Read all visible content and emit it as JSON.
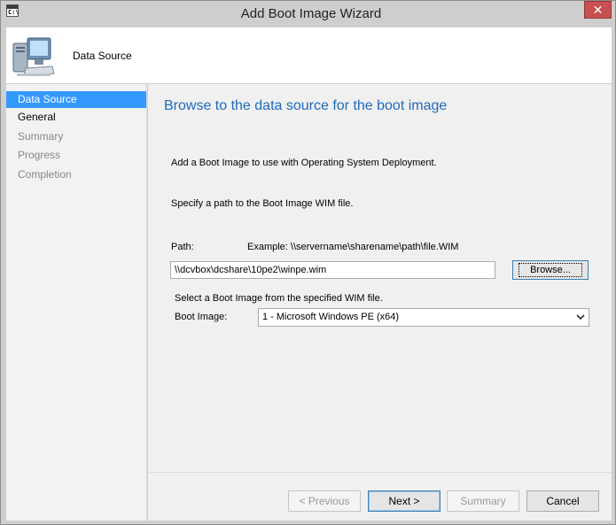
{
  "window": {
    "title": "Add Boot Image Wizard",
    "close_glyph": "✕",
    "app_icon_text": "C:\\"
  },
  "header": {
    "title": "Data Source",
    "icon": "computer-icon"
  },
  "sidebar": {
    "items": [
      {
        "label": "Data Source",
        "state": "active"
      },
      {
        "label": "General",
        "state": "done"
      },
      {
        "label": "Summary",
        "state": "pending"
      },
      {
        "label": "Progress",
        "state": "pending"
      },
      {
        "label": "Completion",
        "state": "pending"
      }
    ]
  },
  "main": {
    "title": "Browse to the data source for the boot image",
    "intro": "Add a Boot Image to use with Operating System Deployment.",
    "specify": "Specify a path to the Boot Image WIM file.",
    "path_label": "Path:",
    "path_example": "Example: \\\\servername\\sharename\\path\\file.WIM",
    "path_value": "\\\\dcvbox\\dcshare\\10pe2\\winpe.wim",
    "browse_label": "Browse...",
    "select_hint": "Select a Boot Image from the specified WIM file.",
    "boot_image_label": "Boot Image:",
    "boot_image_value": "1 - Microsoft Windows PE (x64)"
  },
  "footer": {
    "previous": "< Previous",
    "next": "Next >",
    "summary": "Summary",
    "cancel": "Cancel"
  },
  "colors": {
    "accent": "#3399ff",
    "title_blue": "#1e6bb8",
    "close_red": "#c75050"
  }
}
